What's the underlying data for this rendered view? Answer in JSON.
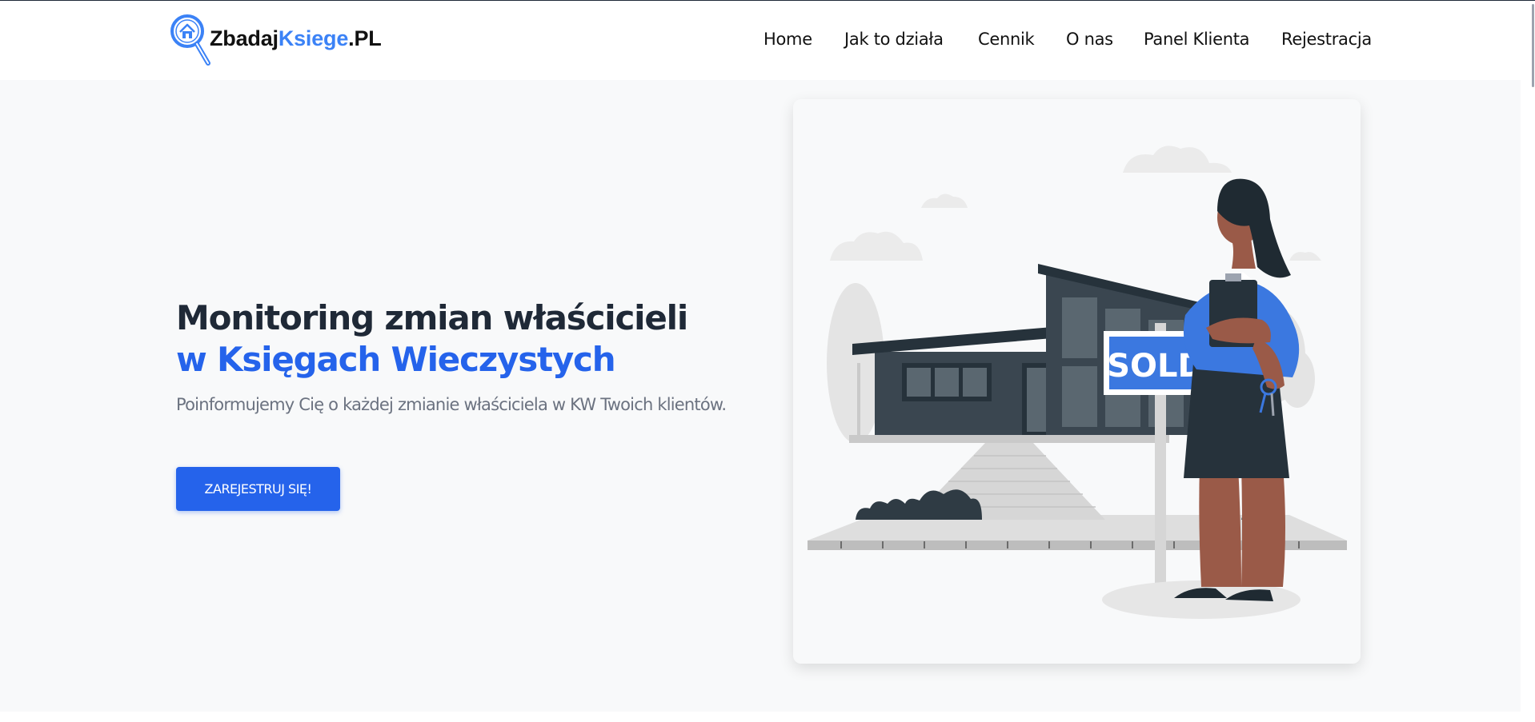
{
  "logo": {
    "part1": "Zbadaj",
    "part2": "Ksiege",
    "part3": ".PL",
    "icon": "magnifier-house-icon"
  },
  "nav": {
    "items": [
      {
        "label": "Home"
      },
      {
        "label": "Jak to działa"
      },
      {
        "label": "Cennik"
      },
      {
        "label": "O nas"
      },
      {
        "label": "Panel Klienta"
      },
      {
        "label": "Rejestracja"
      }
    ]
  },
  "hero": {
    "title_line1": "Monitoring zmian właścicieli",
    "title_line2": "w Księgach Wieczystych",
    "subtitle": "Poinformujemy Cię o każdej zmianie właściciela w KW Twoich klientów.",
    "cta_label": "ZAREJESTRUJ SIĘ!"
  },
  "illustration": {
    "sign_text": "SOLD"
  },
  "colors": {
    "accent": "#2563eb",
    "logo_blue": "#3b82f6",
    "text_dark": "#1f2937",
    "hero_bg": "#f8f9fa"
  }
}
